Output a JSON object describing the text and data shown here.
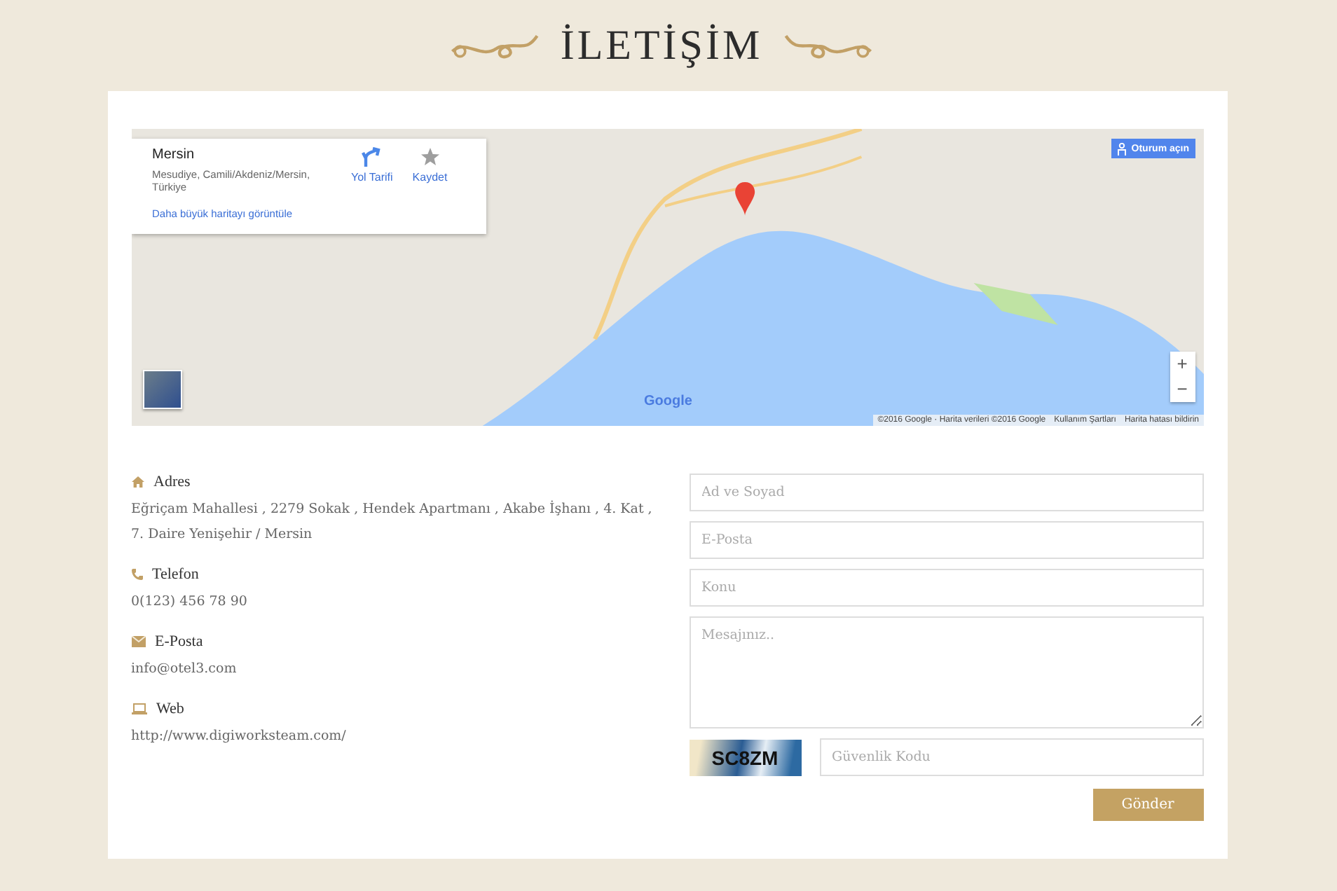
{
  "heading": {
    "title": "İLETİŞİM"
  },
  "map": {
    "place_card": {
      "title": "Mersin",
      "address": "Mesudiye, Camili/Akdeniz/Mersin, Türkiye",
      "actions": [
        {
          "label": "Yol Tarifi",
          "kind": "directions"
        },
        {
          "label": "Kaydet",
          "kind": "save"
        }
      ],
      "link": "Daha büyük haritayı görüntüle"
    },
    "sign_in": "Oturum açın",
    "zoom_in": "+",
    "zoom_out": "−",
    "brand": "Google",
    "footer": [
      "©2016 Google · Harita verileri ©2016 Google",
      "Kullanım Şartları",
      "Harita hatası bildirin"
    ]
  },
  "contact": [
    {
      "kind": "address",
      "label": "Adres",
      "value": "Eğriçam Mahallesi , 2279 Sokak , Hendek Apartmanı , Akabe İşhanı , 4. Kat , 7. Daire Yenişehir / Mersin"
    },
    {
      "kind": "phone",
      "label": "Telefon",
      "value": "0(123) 456 78 90"
    },
    {
      "kind": "email",
      "label": "E-Posta",
      "value": "info@otel3.com"
    },
    {
      "kind": "web",
      "label": "Web",
      "value": "http://www.digiworksteam.com/"
    }
  ],
  "form": {
    "fields": [
      {
        "kind": "input",
        "placeholder": "Ad ve Soyad"
      },
      {
        "kind": "input",
        "placeholder": "E-Posta"
      },
      {
        "kind": "input",
        "placeholder": "Konu"
      },
      {
        "kind": "textarea",
        "placeholder": "Mesajınız.."
      }
    ],
    "captcha": "SC8ZM",
    "security_code": {
      "placeholder": "Güvenlik Kodu"
    },
    "submit": "Gönder"
  }
}
